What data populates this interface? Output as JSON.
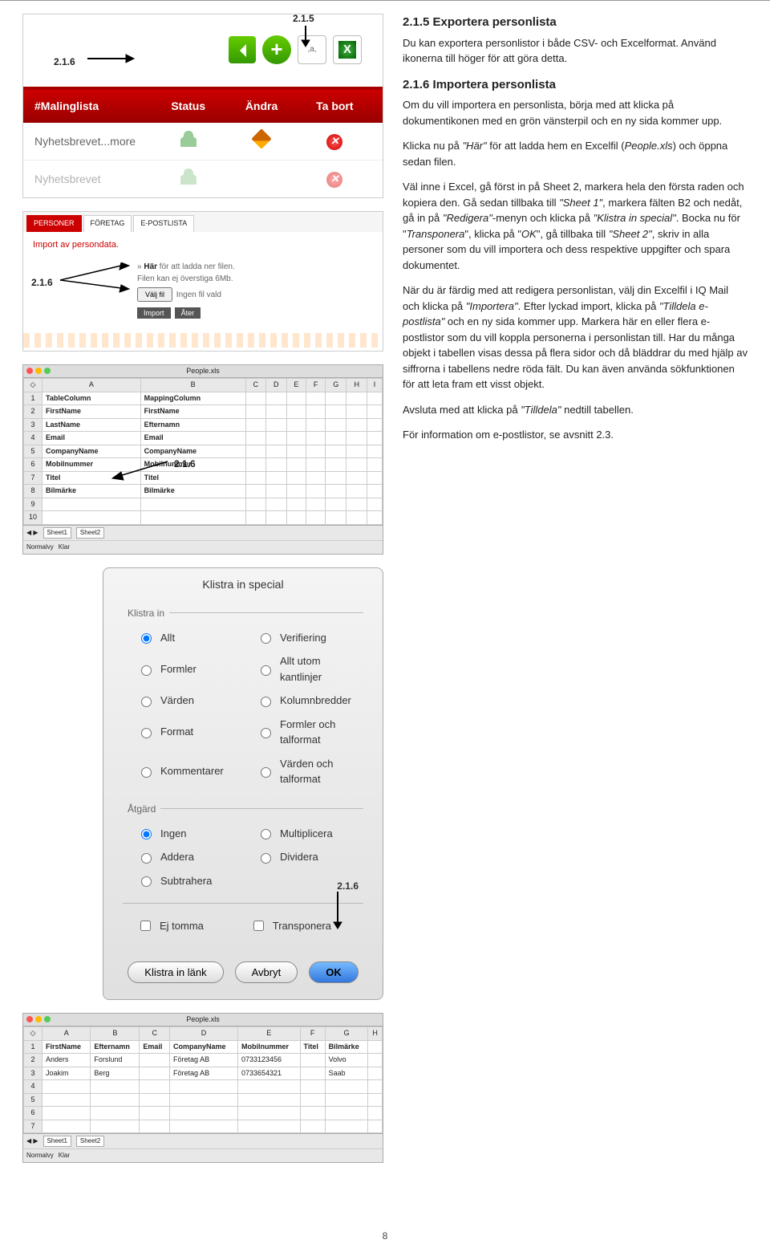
{
  "callouts": {
    "c215": "2.1.5",
    "c216": "2.1.6"
  },
  "fig1": {
    "header": {
      "col1": "#Malinglista",
      "col2": "Status",
      "col3": "Ändra",
      "col4": "Ta bort"
    },
    "rows": [
      {
        "name": "Nyhetsbrevet...more",
        "del": "✕"
      },
      {
        "name": "Nyhetsbrevet",
        "del": "✕"
      }
    ]
  },
  "fig2": {
    "tabs": [
      "PERSONER",
      "FÖRETAG",
      "E-POSTLISTA"
    ],
    "title": "Import av persondata.",
    "linkpre": "» ",
    "link": "Här",
    "linkpost": " för att ladda ner filen.",
    "note": "Filen kan ej överstiga 6Mb.",
    "filebtn": "Välj fil",
    "filestate": "Ingen fil vald",
    "btn1": "Import",
    "btn2": "Åter"
  },
  "xls": {
    "filename": "People.xls",
    "cols": [
      "A",
      "B",
      "C",
      "D",
      "E",
      "F",
      "G",
      "H",
      "I"
    ],
    "rows": [
      [
        "TableColumn",
        "MappingColumn",
        "",
        "",
        "",
        "",
        "",
        "",
        ""
      ],
      [
        "FirstName",
        "FirstName",
        "",
        "",
        "",
        "",
        "",
        "",
        ""
      ],
      [
        "LastName",
        "Efternamn",
        "",
        "",
        "",
        "",
        "",
        "",
        ""
      ],
      [
        "Email",
        "Email",
        "",
        "",
        "",
        "",
        "",
        "",
        ""
      ],
      [
        "CompanyName",
        "CompanyName",
        "",
        "",
        "",
        "",
        "",
        "",
        ""
      ],
      [
        "Mobilnummer",
        "Mobilnummer",
        "",
        "",
        "",
        "",
        "",
        "",
        ""
      ],
      [
        "Titel",
        "Titel",
        "",
        "",
        "",
        "",
        "",
        "",
        ""
      ],
      [
        "Bilmärke",
        "Bilmärke",
        "",
        "",
        "",
        "",
        "",
        "",
        ""
      ]
    ],
    "sheets": [
      "Sheet1",
      "Sheet2"
    ],
    "status": "Normalvy",
    "ready": "Klar"
  },
  "dialog": {
    "title": "Klistra in special",
    "sec1": "Klistra in",
    "opts1": [
      [
        "Allt",
        true
      ],
      [
        "Verifiering",
        false
      ],
      [
        "Formler",
        false
      ],
      [
        "Allt utom kantlinjer",
        false
      ],
      [
        "Värden",
        false
      ],
      [
        "Kolumnbredder",
        false
      ],
      [
        "Format",
        false
      ],
      [
        "Formler och talformat",
        false
      ],
      [
        "Kommentarer",
        false
      ],
      [
        "Värden och talformat",
        false
      ]
    ],
    "sec2": "Åtgärd",
    "opts2": [
      [
        "Ingen",
        true
      ],
      [
        "Multiplicera",
        false
      ],
      [
        "Addera",
        false
      ],
      [
        "Dividera",
        false
      ],
      [
        "Subtrahera",
        false
      ]
    ],
    "chk1": "Ej tomma",
    "chk2": "Transponera",
    "btns": [
      "Klistra in länk",
      "Avbryt",
      "OK"
    ]
  },
  "xls2": {
    "cols": [
      "A",
      "B",
      "C",
      "D",
      "E",
      "F",
      "G",
      "H"
    ],
    "hdr": [
      "FirstName",
      "Efternamn",
      "Email",
      "CompanyName",
      "Mobilnummer",
      "Titel",
      "Bilmärke",
      ""
    ],
    "rows": [
      [
        "Anders",
        "Forslund",
        "",
        "Företag AB",
        "0733123456",
        "",
        "Volvo",
        ""
      ],
      [
        "Joakim",
        "Berg",
        "",
        "Företag AB",
        "0733654321",
        "",
        "Saab",
        ""
      ]
    ]
  },
  "text": {
    "h1": "2.1.5 Exportera personlista",
    "p1": "Du kan exportera personlistor i både CSV- och Excelformat. Använd ikonerna till höger för att göra detta.",
    "h2": "2.1.6 Importera personlista",
    "p2": "Om du vill importera en personlista, börja med att klicka på dokumentikonen med en grön vänsterpil och en ny sida kommer upp.",
    "p3a": "Klicka nu på ",
    "p3i": "\"Här\"",
    "p3b": " för att ladda hem en Excelfil (",
    "p3j": "People.xls",
    "p3c": ") och öppna sedan filen.",
    "p4a": "Väl inne i Excel, gå först in på Sheet 2, markera hela den första raden och kopiera den. Gå sedan tillbaka till ",
    "p4i": "\"Sheet 1\"",
    "p4b": ", markera fälten B2 och nedåt, gå in på ",
    "p4j": "\"Redigera\"",
    "p4c": "-menyn och klicka på ",
    "p4k": "\"Klistra in special\"",
    "p4d": ". Bocka nu för \"",
    "p4l": "Transponera",
    "p4e": "\", klicka på \"",
    "p4m": "OK",
    "p4f": "\", gå tillbaka till ",
    "p4n": "\"Sheet 2\"",
    "p4g": ", skriv in alla personer som du vill importera och dess respektive uppgifter och spara dokumentet.",
    "p5a": "När du är färdig med att redigera personlistan, välj din Excelfil i IQ Mail och klicka på ",
    "p5i": "\"Importera\"",
    "p5b": ". Efter lyckad import, klicka på ",
    "p5j": "\"Tilldela e-postlista\"",
    "p5c": " och en ny sida kommer upp. Markera här en eller flera e-postlistor som du vill koppla personerna i personlistan till. Har du många objekt i tabellen visas dessa på flera sidor och då bläddrar du med hjälp av siffrorna i tabellens nedre röda fält. Du kan även använda sökfunktionen för att leta fram ett visst objekt.",
    "p6a": "Avsluta med att klicka på ",
    "p6i": "\"Tilldela\"",
    "p6b": " nedtill tabellen.",
    "p7": "För information om e-postlistor, se avsnitt 2.3."
  },
  "pagenum": "8"
}
